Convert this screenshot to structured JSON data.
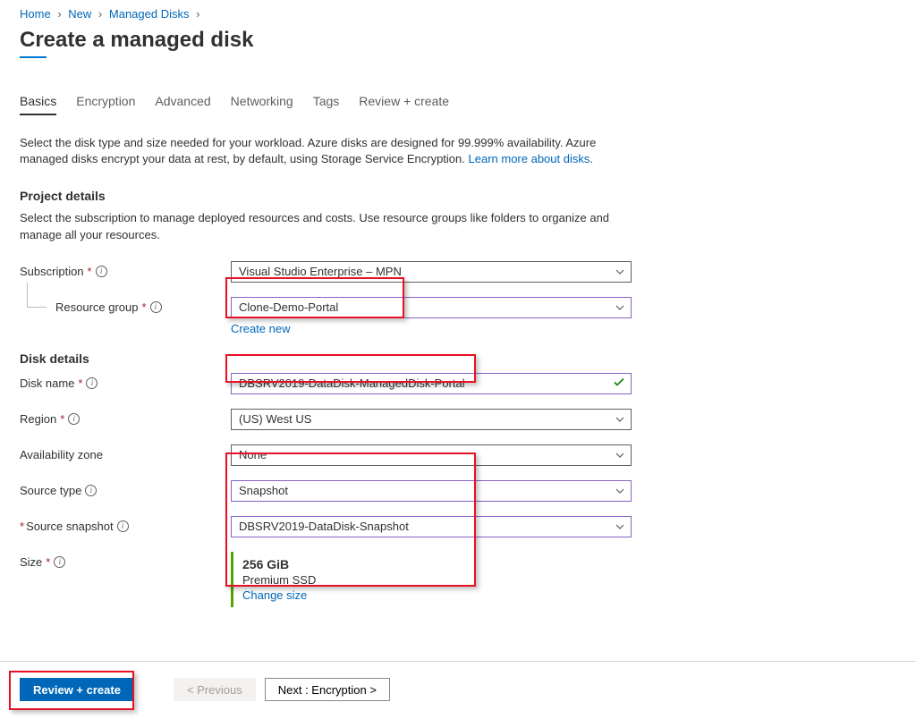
{
  "breadcrumb": {
    "items": [
      "Home",
      "New",
      "Managed Disks"
    ]
  },
  "page": {
    "title": "Create a managed disk"
  },
  "tabs": {
    "items": [
      {
        "label": "Basics",
        "active": true
      },
      {
        "label": "Encryption",
        "active": false
      },
      {
        "label": "Advanced",
        "active": false
      },
      {
        "label": "Networking",
        "active": false
      },
      {
        "label": "Tags",
        "active": false
      },
      {
        "label": "Review + create",
        "active": false
      }
    ]
  },
  "intro": {
    "text": "Select the disk type and size needed for your workload. Azure disks are designed for 99.999% availability. Azure managed disks encrypt your data at rest, by default, using Storage Service Encryption.  ",
    "link_text": "Learn more about disks."
  },
  "project_details": {
    "heading": "Project details",
    "desc": "Select the subscription to manage deployed resources and costs. Use resource groups like folders to organize and manage all your resources.",
    "subscription_label": "Subscription",
    "subscription_value": "Visual Studio Enterprise – MPN",
    "resource_group_label": "Resource group",
    "resource_group_value": "Clone-Demo-Portal",
    "create_new": "Create new"
  },
  "disk_details": {
    "heading": "Disk details",
    "disk_name_label": "Disk name",
    "disk_name_value": "DBSRV2019-DataDisk-ManagedDisk-Portal",
    "region_label": "Region",
    "region_value": "(US) West US",
    "availability_zone_label": "Availability zone",
    "availability_zone_value": "None",
    "source_type_label": "Source type",
    "source_type_value": "Snapshot",
    "source_snapshot_label": "Source snapshot",
    "source_snapshot_value": "DBSRV2019-DataDisk-Snapshot",
    "size_label": "Size",
    "size_value": "256 GiB",
    "size_tier": "Premium SSD",
    "change_size": "Change size"
  },
  "footer": {
    "review_create": "Review + create",
    "previous": "<  Previous",
    "next": "Next : Encryption  >"
  }
}
